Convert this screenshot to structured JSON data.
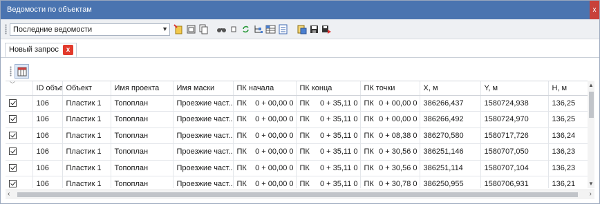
{
  "window": {
    "title": "Ведомости по объектам",
    "close": "x"
  },
  "toolbar": {
    "combo_value": "Последние ведомости"
  },
  "tab": {
    "label": "Новый запрос",
    "close": "x"
  },
  "table": {
    "columns": [
      "",
      "ID объе",
      "Объект",
      "Имя проекта",
      "Имя маски",
      "ПК начала",
      "ПК конца",
      "ПК точки",
      "X, м",
      "Y, м",
      "H, м"
    ],
    "rows": [
      {
        "checked": true,
        "id": "106",
        "object": "Пластик 1",
        "project": "Топоплан",
        "mask": "Проезжие част...",
        "pk_start": [
          "ПК",
          "0 + 00,00",
          "0"
        ],
        "pk_end": [
          "ПК",
          "0 + 35,11",
          "0"
        ],
        "pk_point": [
          "ПК",
          "0 + 00,00",
          "0"
        ],
        "x": "386266,437",
        "y": "1580724,938",
        "h": "136,25"
      },
      {
        "checked": true,
        "id": "106",
        "object": "Пластик 1",
        "project": "Топоплан",
        "mask": "Проезжие част...",
        "pk_start": [
          "ПК",
          "0 + 00,00",
          "0"
        ],
        "pk_end": [
          "ПК",
          "0 + 35,11",
          "0"
        ],
        "pk_point": [
          "ПК",
          "0 + 00,00",
          "0"
        ],
        "x": "386266,492",
        "y": "1580724,970",
        "h": "136,25"
      },
      {
        "checked": true,
        "id": "106",
        "object": "Пластик 1",
        "project": "Топоплан",
        "mask": "Проезжие част...",
        "pk_start": [
          "ПК",
          "0 + 00,00",
          "0"
        ],
        "pk_end": [
          "ПК",
          "0 + 35,11",
          "0"
        ],
        "pk_point": [
          "ПК",
          "0 + 08,38",
          "0"
        ],
        "x": "386270,580",
        "y": "1580717,726",
        "h": "136,24"
      },
      {
        "checked": true,
        "id": "106",
        "object": "Пластик 1",
        "project": "Топоплан",
        "mask": "Проезжие част...",
        "pk_start": [
          "ПК",
          "0 + 00,00",
          "0"
        ],
        "pk_end": [
          "ПК",
          "0 + 35,11",
          "0"
        ],
        "pk_point": [
          "ПК",
          "0 + 30,56",
          "0"
        ],
        "x": "386251,146",
        "y": "1580707,050",
        "h": "136,23"
      },
      {
        "checked": true,
        "id": "106",
        "object": "Пластик 1",
        "project": "Топоплан",
        "mask": "Проезжие част...",
        "pk_start": [
          "ПК",
          "0 + 00,00",
          "0"
        ],
        "pk_end": [
          "ПК",
          "0 + 35,11",
          "0"
        ],
        "pk_point": [
          "ПК",
          "0 + 30,56",
          "0"
        ],
        "x": "386251,114",
        "y": "1580707,104",
        "h": "136,23"
      },
      {
        "checked": true,
        "id": "106",
        "object": "Пластик 1",
        "project": "Топоплан",
        "mask": "Проезжие част...",
        "pk_start": [
          "ПК",
          "0 + 00,00",
          "0"
        ],
        "pk_end": [
          "ПК",
          "0 + 35,11",
          "0"
        ],
        "pk_point": [
          "ПК",
          "0 + 30,78",
          "0"
        ],
        "x": "386250,955",
        "y": "1580706,931",
        "h": "136,21"
      }
    ]
  },
  "colors": {
    "titlebar": "#4a74b0",
    "close": "#c8413a",
    "tab_close": "#e23a2c"
  }
}
